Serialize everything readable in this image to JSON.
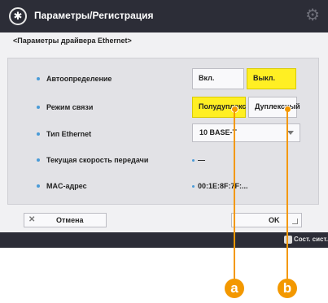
{
  "title": "Параметры/Регистрация",
  "subtitle": "<Параметры драйвера Ethernet>",
  "rows": [
    {
      "label": "Автоопределение",
      "options": [
        "Вкл.",
        "Выкл."
      ],
      "selected": "Выкл."
    },
    {
      "label": "Режим связи",
      "options": [
        "Полудуплекс",
        "Дуплексный"
      ],
      "selected": "Полудуплекс"
    },
    {
      "label": "Тип Ethernet",
      "select_value": "10 BASE-T"
    },
    {
      "label": "Текущая скорость передачи",
      "value": "—"
    },
    {
      "label": "MAC-адрес",
      "value": "00:1E:8F:7F:..."
    }
  ],
  "buttons": {
    "cancel": "Отмена",
    "ok": "OK"
  },
  "status": {
    "text": "Сост. сист."
  },
  "callouts": [
    "a",
    "b"
  ],
  "colors": {
    "titlebar": "#2c2d37",
    "selected": "#ffef23",
    "accent": "#f39800",
    "bullet": "#4a9bd7"
  },
  "icons": {
    "title": "settings-register-icon",
    "gear": "gear-icon",
    "cancel": "close-icon",
    "status": "system-status-icon"
  }
}
